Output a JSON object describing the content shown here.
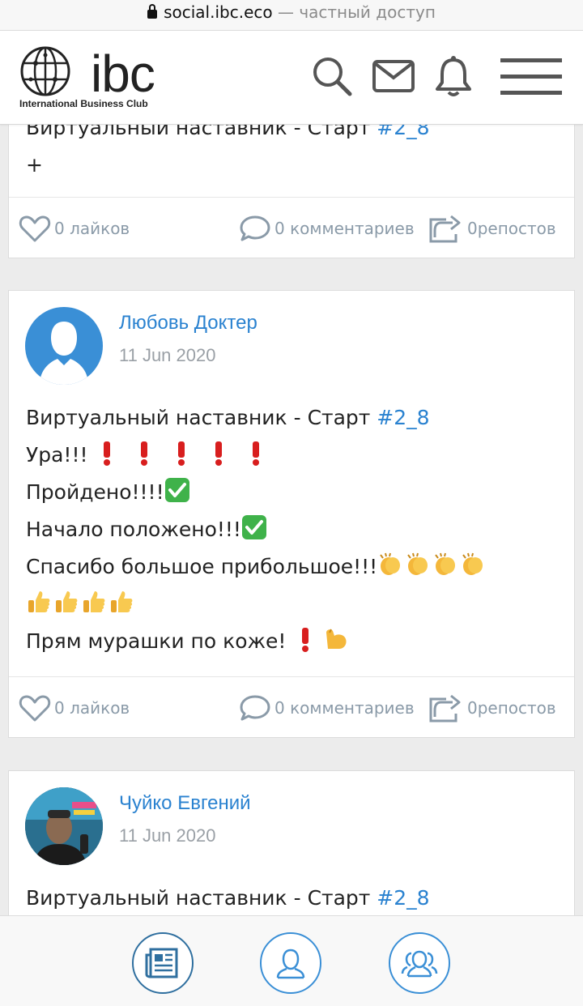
{
  "browser": {
    "domain": "social.ibc.eco",
    "suffix": " — частный доступ"
  },
  "header": {
    "logo_text": "ibc",
    "logo_sub": "International Business Club",
    "icons": [
      "search-icon",
      "mail-icon",
      "bell-icon",
      "menu-icon"
    ]
  },
  "posts": [
    {
      "text_partial": "Виртуальный наставник - Старт ",
      "tag": "#2_8",
      "line2": "+",
      "likes": "0 лайков",
      "comments": "0 комментариев",
      "reposts": "0репостов"
    },
    {
      "author": "Любовь Доктер",
      "date": "11 Jun 2020",
      "line1": "Виртуальный наставник - Старт ",
      "tag": "#2_8",
      "line2": "Ура!!! ",
      "line3": " Пройдено!!!!",
      "line4": "Начало положено!!!",
      "line5": "Спасибо большое прибольшое!!!",
      "line7": "Прям мурашки по коже! ",
      "likes": "0 лайков",
      "comments": "0 комментариев",
      "reposts": "0репостов"
    },
    {
      "author": "Чуйко Евгений",
      "date": "11 Jun 2020",
      "line1": "Виртуальный наставник - Старт ",
      "tag": "#2_8"
    }
  ],
  "colors": {
    "link": "#2a82d0",
    "meta": "#8a9aa8",
    "nav_ring": "#2f6f9f"
  },
  "bottom_nav": [
    "news-icon",
    "profile-icon",
    "groups-icon"
  ]
}
